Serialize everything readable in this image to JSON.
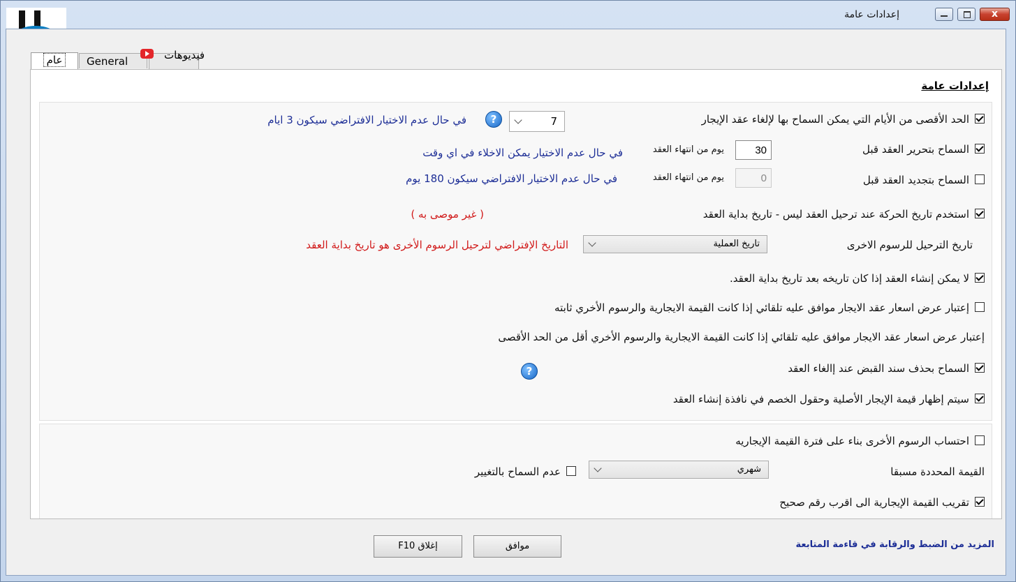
{
  "window": {
    "title": "إعدادات عامة",
    "close_label": "x"
  },
  "tabs": [
    {
      "label": "عام"
    },
    {
      "label": "General"
    },
    {
      "label": "فيديوهات"
    }
  ],
  "section": {
    "title": "إعدادات عامة"
  },
  "settings": {
    "max_days": {
      "checked": true,
      "label": "الحد الأقصى من الأيام التي يمكن السماح بها لإلغاء عقد الإيجار",
      "value": "7",
      "note": "في حال عدم الاختيار الافتراضي سيكون 3 ايام"
    },
    "edit_before": {
      "checked": true,
      "label": "السماح بتحرير العقد قبل",
      "value": "30",
      "unit": "يوم من انتهاء العقد",
      "note": "في حال عدم الاختيار يمكن الاخلاء في اي وقت"
    },
    "renew_before": {
      "checked": false,
      "label": "السماح بتجديد العقد قبل",
      "value": "0",
      "unit": "يوم من انتهاء العقد",
      "note": "في حال عدم الاختيار الافتراضي سيكون 180 يوم"
    },
    "move_date": {
      "checked": true,
      "label": "استخدم تاريخ الحركة عند ترحيل العقد ليس - تاريخ بداية العقد",
      "note": "( غير موصى به )"
    },
    "other_fees_date": {
      "label": "تاريخ الترحيل للرسوم الاخرى",
      "value": "تاريخ العملية",
      "note": "التاريخ الإفتراضي لترحيل الرسوم الأخرى هو تاريخ بداية العقد"
    },
    "no_create_after": {
      "checked": true,
      "label": "لا يمكن إنشاء العقد إذا كان تاريخه بعد تاريخ بداية العقد."
    },
    "auto_approve_fixed": {
      "checked": false,
      "label": "إعتبار عرض اسعار عقد الايجار موافق عليه تلقائي  إذا كانت القيمة الايجارية والرسوم الأخري ثابته"
    },
    "auto_approve_less": {
      "label": "إعتبار عرض اسعار عقد الايجار موافق عليه تلقائي  إذا كانت القيمة الايجارية والرسوم الأخري أقل من الحد الأقصى"
    },
    "delete_receipt": {
      "checked": true,
      "label": "السماح بحذف سند القبض عند إالغاء العقد"
    },
    "show_original": {
      "checked": true,
      "label": "سيتم إظهار قيمة الإيجار الأصلية وحقول الخصم في نافذة إنشاء العقد"
    },
    "calc_fees": {
      "checked": false,
      "label": "احتساب الرسوم الأخرى بناء على فترة القيمة الإيجاريه"
    },
    "preset_value": {
      "label": "القيمة المحددة مسبقا",
      "value": "شهري",
      "no_change_checked": false,
      "no_change_label": "عدم السماح بالتغيير"
    },
    "round_value": {
      "checked": true,
      "label": "تقريب القيمة الإيجارية الى اقرب رقم صحيح"
    }
  },
  "buttons": {
    "ok": "موافق",
    "close": "إغلاق F10"
  },
  "footer_link": "المزيد من الضبط والرقابة في قاءمة المتابعة"
}
